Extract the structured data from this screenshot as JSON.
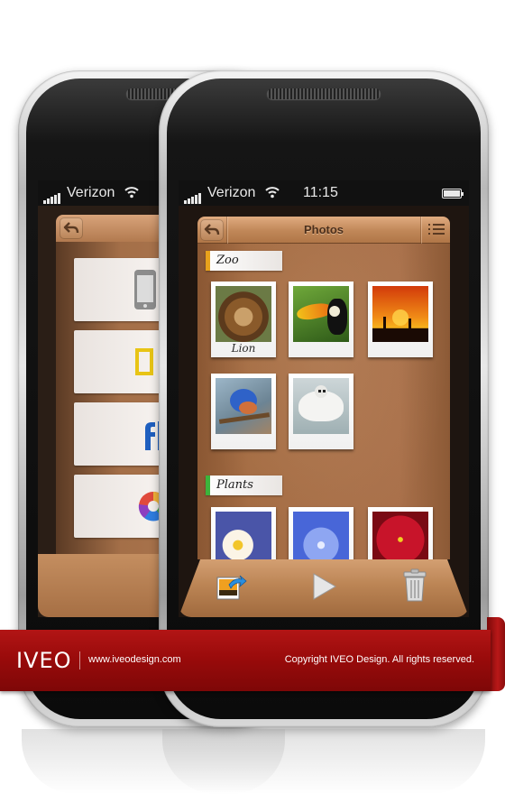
{
  "back_phone": {
    "status_bar": {
      "carrier": "Verizon"
    }
  },
  "front_phone": {
    "status_bar": {
      "carrier": "Verizon",
      "time": "11:15"
    },
    "header": {
      "title": "Photos"
    },
    "sections": [
      {
        "name": "Zoo",
        "accent": "#e8a21c",
        "photos": [
          {
            "caption": "Lion"
          },
          {
            "caption": ""
          },
          {
            "caption": ""
          },
          {
            "caption": ""
          },
          {
            "caption": ""
          }
        ]
      },
      {
        "name": "Plants",
        "accent": "#3cb43c",
        "photos": [
          {
            "caption": ""
          },
          {
            "caption": ""
          },
          {
            "caption": ""
          }
        ]
      }
    ],
    "toolbar": {
      "buttons": [
        {
          "icon": "share-photo-icon"
        },
        {
          "icon": "play-icon"
        },
        {
          "icon": "trash-icon"
        }
      ]
    }
  },
  "banner": {
    "logo": "IVEO",
    "url": "www.iveodesign.com",
    "copyright": "Copyright IVEO Design. All rights reserved."
  },
  "colors": {
    "wood": "#a96e45",
    "banner_red": "#9a0b0b"
  }
}
